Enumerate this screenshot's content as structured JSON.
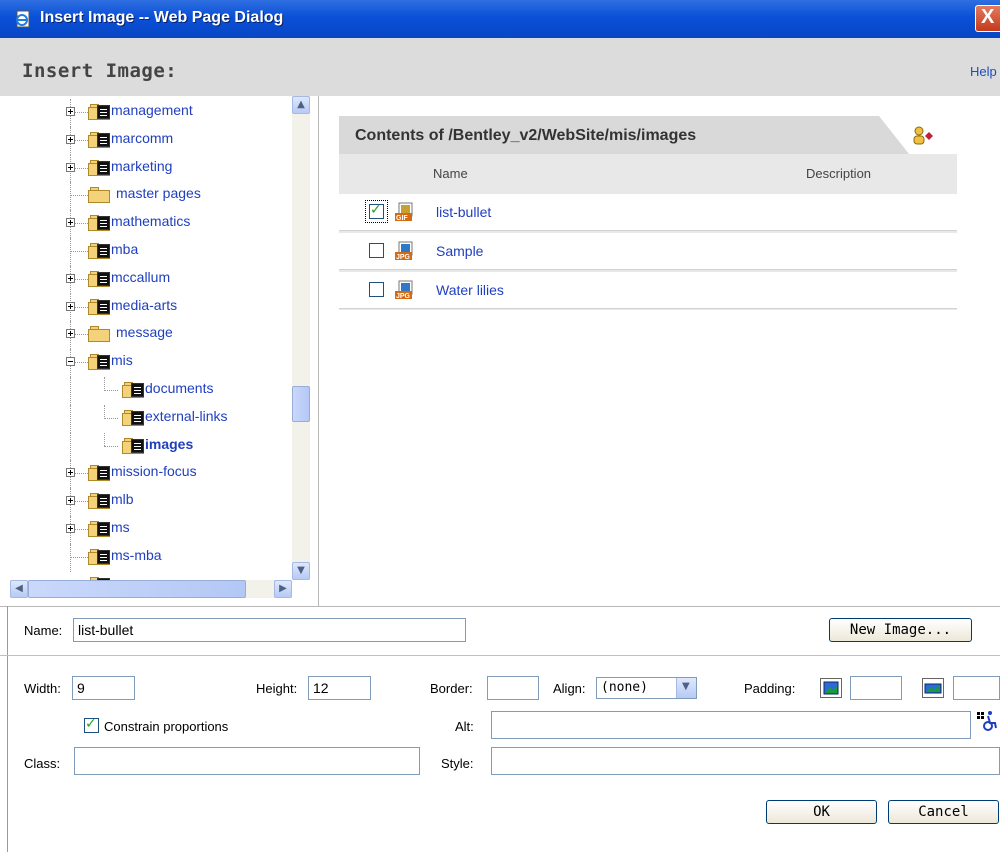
{
  "window": {
    "title": "Insert Image -- Web Page Dialog",
    "close_label": "X"
  },
  "header": {
    "title": "Insert Image:",
    "help": "Help"
  },
  "tree": {
    "items": [
      {
        "label": "management",
        "expander": "plus",
        "level": 0,
        "doc": true
      },
      {
        "label": "marcomm",
        "expander": "plus",
        "level": 0,
        "doc": true
      },
      {
        "label": "marketing",
        "expander": "plus",
        "level": 0,
        "doc": true
      },
      {
        "label": "master pages",
        "expander": "none",
        "level": 0,
        "doc": false
      },
      {
        "label": "mathematics",
        "expander": "plus",
        "level": 0,
        "doc": true
      },
      {
        "label": "mba",
        "expander": "none",
        "level": 0,
        "doc": true
      },
      {
        "label": "mccallum",
        "expander": "plus",
        "level": 0,
        "doc": true
      },
      {
        "label": "media-arts",
        "expander": "plus",
        "level": 0,
        "doc": true
      },
      {
        "label": "message",
        "expander": "plus",
        "level": 0,
        "doc": false
      },
      {
        "label": "mis",
        "expander": "minus",
        "level": 0,
        "doc": true
      },
      {
        "label": "documents",
        "expander": "none",
        "level": 1,
        "doc": true
      },
      {
        "label": "external-links",
        "expander": "none",
        "level": 1,
        "doc": true
      },
      {
        "label": "images",
        "expander": "none",
        "level": 1,
        "doc": true,
        "selected": true
      },
      {
        "label": "mission-focus",
        "expander": "plus",
        "level": 0,
        "doc": true
      },
      {
        "label": "mlb",
        "expander": "plus",
        "level": 0,
        "doc": true
      },
      {
        "label": "ms",
        "expander": "plus",
        "level": 0,
        "doc": true
      },
      {
        "label": "ms-mba",
        "expander": "none",
        "level": 0,
        "doc": true
      }
    ]
  },
  "contents": {
    "title": "Contents of /Bentley_v2/WebSite/mis/images",
    "col_name": "Name",
    "col_description": "Description",
    "files": [
      {
        "name": "list-bullet",
        "type": "GIF",
        "checked": true
      },
      {
        "name": "Sample",
        "type": "JPG",
        "checked": false
      },
      {
        "name": "Water lilies",
        "type": "JPG",
        "checked": false
      }
    ]
  },
  "form": {
    "name_label": "Name:",
    "name_value": "list-bullet",
    "new_image": "New Image...",
    "width_label": "Width:",
    "width_value": "9",
    "height_label": "Height:",
    "height_value": "12",
    "border_label": "Border:",
    "border_value": "",
    "align_label": "Align:",
    "align_value": "(none)",
    "padding_label": "Padding:",
    "constrain_label": "Constrain proportions",
    "constrain_checked": true,
    "alt_label": "Alt:",
    "alt_value": "",
    "class_label": "Class:",
    "class_value": "",
    "style_label": "Style:",
    "style_value": "",
    "ok": "OK",
    "cancel": "Cancel"
  },
  "colors": {
    "titlebar": "#0a50d8",
    "link": "#1f3fbf",
    "header_bg": "#dcdcdc",
    "check_green": "#21a121"
  }
}
